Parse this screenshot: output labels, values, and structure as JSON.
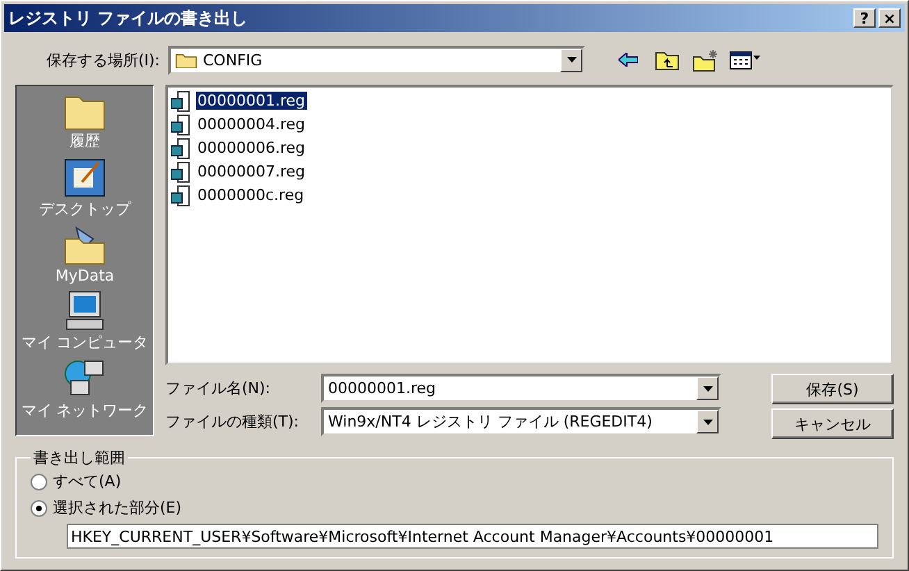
{
  "window": {
    "title": "レジストリ ファイルの書き出し",
    "help": "?",
    "close": "×"
  },
  "location": {
    "label": "保存する場所(I):",
    "value": "CONFIG"
  },
  "places": [
    {
      "label": "履歴",
      "kind": "folder"
    },
    {
      "label": "デスクトップ",
      "kind": "desktop"
    },
    {
      "label": "MyData",
      "kind": "docs"
    },
    {
      "label": "マイ コンピュータ",
      "kind": "computer"
    },
    {
      "label": "マイ ネットワーク",
      "kind": "network"
    }
  ],
  "files": [
    {
      "name": "00000001.reg",
      "selected": true
    },
    {
      "name": "00000004.reg",
      "selected": false
    },
    {
      "name": "00000006.reg",
      "selected": false
    },
    {
      "name": "00000007.reg",
      "selected": false
    },
    {
      "name": "0000000c.reg",
      "selected": false
    }
  ],
  "filename": {
    "label": "ファイル名(N):",
    "value": "00000001.reg"
  },
  "filetype": {
    "label": "ファイルの種類(T):",
    "value": "Win9x/NT4 レジストリ ファイル (REGEDIT4)"
  },
  "buttons": [
    "保存(S)",
    "キャンセル"
  ],
  "range": {
    "title": "書き出し範囲",
    "options": [
      {
        "label": "すべて(A)",
        "selected": false
      },
      {
        "label": "選択された部分(E)",
        "selected": true
      }
    ],
    "branch": "HKEY_CURRENT_USER¥Software¥Microsoft¥Internet Account Manager¥Accounts¥00000001"
  }
}
